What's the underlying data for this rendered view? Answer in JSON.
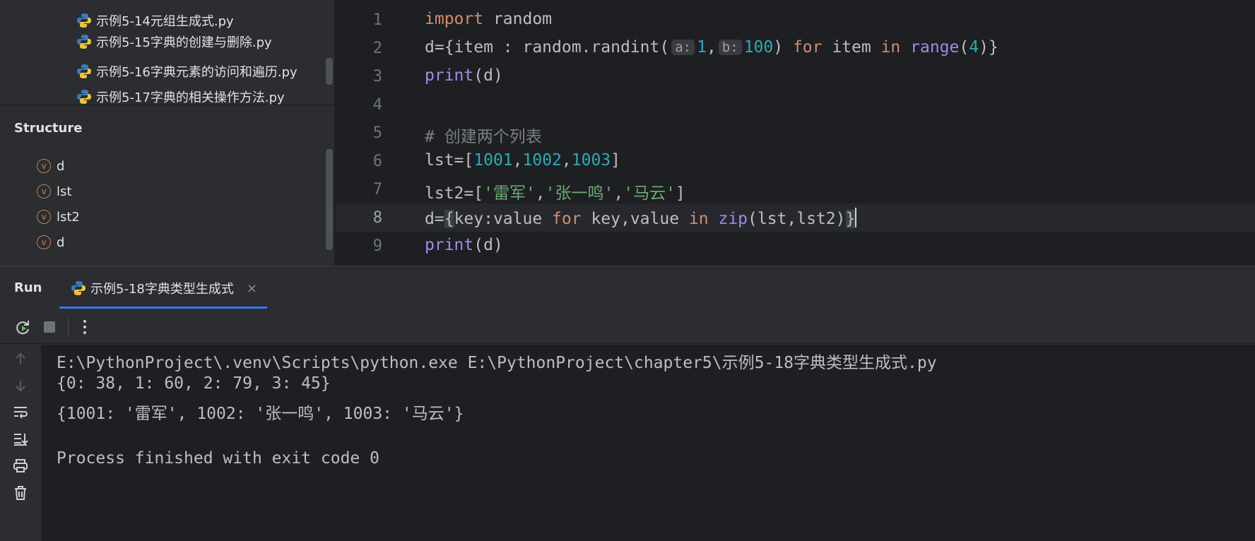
{
  "project_tree": {
    "items": [
      {
        "label": "示例5-14元组生成式.py"
      },
      {
        "label": "示例5-15字典的创建与删除.py"
      },
      {
        "label": "示例5-16字典元素的访问和遍历.py"
      },
      {
        "label": "示例5-17字典的相关操作方法.py"
      }
    ]
  },
  "structure": {
    "title": "Structure",
    "icon_letter": "v",
    "items": [
      {
        "label": "d"
      },
      {
        "label": "lst"
      },
      {
        "label": "lst2"
      },
      {
        "label": "d"
      }
    ]
  },
  "editor": {
    "current_line": 8,
    "line_numbers": [
      "1",
      "2",
      "3",
      "4",
      "5",
      "6",
      "7",
      "8",
      "9"
    ],
    "tokens": {
      "l1": {
        "a": "import",
        "b": " random"
      },
      "l2": {
        "a": "d={item : random.randint(",
        "h1": "a:",
        "n1": "1",
        "c": ",",
        "h2": "b:",
        "n2": "100",
        "d": ") ",
        "kw1": "for",
        "e": " item ",
        "kw2": "in",
        "f": " ",
        "fn": "range",
        "g": "(",
        "n3": "4",
        "h": ")}"
      },
      "l3": {
        "fn": "print",
        "a": "(d)"
      },
      "l5": {
        "cmt": "# 创建两个列表"
      },
      "l6": {
        "a": "lst=[",
        "n1": "1001",
        "c1": ",",
        "n2": "1002",
        "c2": ",",
        "n3": "1003",
        "b": "]"
      },
      "l7": {
        "a": "lst2=[",
        "s1": "'雷军'",
        "c1": ",",
        "s2": "'张一鸣'",
        "c2": ",",
        "s3": "'马云'",
        "b": "]"
      },
      "l8": {
        "a": "d=",
        "br1": "{",
        "b": "key:value ",
        "kw1": "for",
        "c": " key,value ",
        "kw2": "in",
        "d": " ",
        "fn": "zip",
        "e": "(lst,lst2)",
        "br2": "}"
      },
      "l9": {
        "fn": "print",
        "a": "(d)"
      }
    }
  },
  "run": {
    "title": "Run",
    "tab_label": "示例5-18字典类型生成式",
    "tab_close": "×"
  },
  "console": {
    "lines": [
      "E:\\PythonProject\\.venv\\Scripts\\python.exe E:\\PythonProject\\chapter5\\示例5-18字典类型生成式.py",
      "{0: 38, 1: 60, 2: 79, 3: 45}",
      "{1001: '雷军', 1002: '张一鸣', 1003: '马云'}",
      "Process finished with exit code 0"
    ]
  },
  "colors": {
    "keyword": "#cf8e6d",
    "function": "#9b8de8",
    "number": "#2aacb8",
    "string": "#6aab73",
    "comment": "#7a7e85",
    "accent": "#3574f0"
  }
}
